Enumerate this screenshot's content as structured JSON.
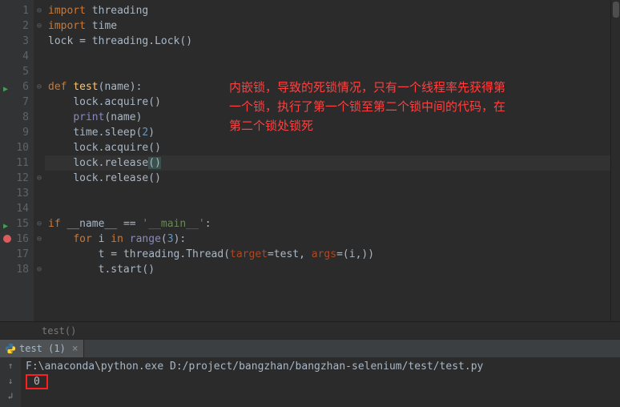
{
  "editor": {
    "lines": [
      {
        "no": 1,
        "fold": "⊖",
        "tokens": [
          [
            "kw",
            "import"
          ],
          [
            "punct",
            " "
          ],
          [
            "ident",
            "threading"
          ]
        ]
      },
      {
        "no": 2,
        "fold": "⊖",
        "tokens": [
          [
            "kw",
            "import"
          ],
          [
            "punct",
            " "
          ],
          [
            "ident",
            "time"
          ]
        ]
      },
      {
        "no": 3,
        "tokens": [
          [
            "ident",
            "lock "
          ],
          [
            "punct",
            "= "
          ],
          [
            "ident",
            "threading"
          ],
          [
            "punct",
            "."
          ],
          [
            "ident",
            "Lock"
          ],
          [
            "punct",
            "()"
          ]
        ]
      },
      {
        "no": 4,
        "tokens": []
      },
      {
        "no": 5,
        "tokens": []
      },
      {
        "no": 6,
        "run": true,
        "fold": "⊖",
        "tokens": [
          [
            "kw",
            "def "
          ],
          [
            "fn",
            "test"
          ],
          [
            "punct",
            "(name):"
          ]
        ]
      },
      {
        "no": 7,
        "tokens": [
          [
            "punct",
            "    "
          ],
          [
            "ident",
            "lock"
          ],
          [
            "punct",
            "."
          ],
          [
            "ident",
            "acquire"
          ],
          [
            "punct",
            "()"
          ]
        ]
      },
      {
        "no": 8,
        "tokens": [
          [
            "punct",
            "    "
          ],
          [
            "builtin",
            "print"
          ],
          [
            "punct",
            "(name)"
          ]
        ]
      },
      {
        "no": 9,
        "tokens": [
          [
            "punct",
            "    "
          ],
          [
            "ident",
            "time"
          ],
          [
            "punct",
            "."
          ],
          [
            "ident",
            "sleep"
          ],
          [
            "punct",
            "("
          ],
          [
            "num",
            "2"
          ],
          [
            "punct",
            ")"
          ]
        ]
      },
      {
        "no": 10,
        "tokens": [
          [
            "punct",
            "    "
          ],
          [
            "ident",
            "lock"
          ],
          [
            "punct",
            "."
          ],
          [
            "ident",
            "acquire"
          ],
          [
            "punct",
            "()"
          ]
        ]
      },
      {
        "no": 11,
        "current": true,
        "tokens": [
          [
            "punct",
            "    "
          ],
          [
            "ident",
            "lock"
          ],
          [
            "punct",
            "."
          ],
          [
            "ident",
            "release"
          ],
          [
            "paren-highlight",
            "("
          ],
          [
            "paren-highlight",
            ")"
          ]
        ]
      },
      {
        "no": 12,
        "fold": "⊖",
        "tokens": [
          [
            "punct",
            "    "
          ],
          [
            "ident",
            "lock"
          ],
          [
            "punct",
            "."
          ],
          [
            "ident",
            "release"
          ],
          [
            "punct",
            "()"
          ]
        ]
      },
      {
        "no": 13,
        "tokens": []
      },
      {
        "no": 14,
        "tokens": []
      },
      {
        "no": 15,
        "run": true,
        "fold": "⊖",
        "tokens": [
          [
            "kw",
            "if "
          ],
          [
            "ident",
            "__name__ "
          ],
          [
            "punct",
            "== "
          ],
          [
            "str",
            "'__main__'"
          ],
          [
            "punct",
            ":"
          ]
        ]
      },
      {
        "no": 16,
        "breakpoint": true,
        "fold": "⊖",
        "tokens": [
          [
            "punct",
            "    "
          ],
          [
            "kw",
            "for "
          ],
          [
            "ident",
            "i "
          ],
          [
            "kw",
            "in "
          ],
          [
            "builtin",
            "range"
          ],
          [
            "punct",
            "("
          ],
          [
            "num",
            "3"
          ],
          [
            "punct",
            "):"
          ]
        ]
      },
      {
        "no": 17,
        "tokens": [
          [
            "punct",
            "        "
          ],
          [
            "ident",
            "t "
          ],
          [
            "punct",
            "= "
          ],
          [
            "ident",
            "threading"
          ],
          [
            "punct",
            "."
          ],
          [
            "ident",
            "Thread"
          ],
          [
            "punct",
            "("
          ],
          [
            "param",
            "target"
          ],
          [
            "punct",
            "=test"
          ],
          [
            "punct",
            ", "
          ],
          [
            "param",
            "args"
          ],
          [
            "punct",
            "=(i"
          ],
          [
            "punct",
            ",))"
          ]
        ]
      },
      {
        "no": 18,
        "fold": "⊖",
        "tokens": [
          [
            "punct",
            "        "
          ],
          [
            "ident",
            "t"
          ],
          [
            "punct",
            "."
          ],
          [
            "ident",
            "start"
          ],
          [
            "punct",
            "()"
          ]
        ]
      }
    ],
    "annotation_l1": "内嵌锁，导致的死锁情况，只有一个线程率先获得第",
    "annotation_l2": "一个锁，执行了第一个锁至第二个锁中间的代码，在",
    "annotation_l3": "第二个锁处锁死"
  },
  "breadcrumb": "test()",
  "console": {
    "tab_label": "test (1)",
    "cmd": "F:\\anaconda\\python.exe D:/project/bangzhan/bangzhan-selenium/test/test.py",
    "output_0": "0"
  }
}
